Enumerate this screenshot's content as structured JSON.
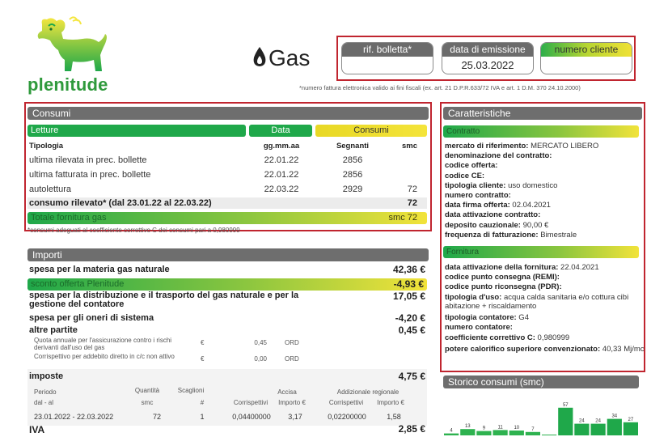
{
  "brand": {
    "name": "plenitude"
  },
  "product": {
    "title": "Gas"
  },
  "header": {
    "rif_bolletta_label": "rif. bolletta*",
    "rif_bolletta_value": "",
    "data_emissione_label": "data di emissione",
    "data_emissione_value": "25.03.2022",
    "numero_cliente_label": "numero cliente",
    "numero_cliente_value": "",
    "footnote": "*numero fattura elettronica valido ai fini fiscali (ex. art. 21 D.P.R.633/72 IVA e art. 1 D.M. 370 24.10.2000)"
  },
  "consumi": {
    "title": "Consumi",
    "bar_letture": "Letture",
    "bar_data": "Data",
    "bar_consumi": "Consumi",
    "col_tipologia": "Tipologia",
    "col_date_format": "gg.mm.aa",
    "col_segnanti": "Segnanti",
    "col_smc": "smc",
    "rows": [
      {
        "tipologia": "ultima rilevata in prec. bollette",
        "data": "22.01.22",
        "segnanti": "2856",
        "smc": ""
      },
      {
        "tipologia": "ultima fatturata in prec. bollette",
        "data": "22.01.22",
        "segnanti": "2856",
        "smc": ""
      },
      {
        "tipologia": "autolettura",
        "data": "22.03.22",
        "segnanti": "2929",
        "smc": "72"
      }
    ],
    "rilevato_label": "consumo rilevato* (dal 23.01.22 al 22.03.22)",
    "rilevato_value": "72",
    "totale_label": "Totale fornitura gas",
    "totale_value": "smc 72",
    "footnote": "*consumi adeguati al coefficiente correttivo C dei consumi pari a 0,980999"
  },
  "importi": {
    "title": "Importi",
    "materia_label": "spesa per la materia gas naturale",
    "materia_value": "42,36 €",
    "sconto_label": "sconto offerta Plenitude",
    "sconto_value": "-4,93 €",
    "distribuzione_label": "spesa per la distribuzione e il trasporto del gas naturale e per la gestione del contatore",
    "distribuzione_value": "17,05 €",
    "oneri_label": "spesa per gli oneri di sistema",
    "oneri_value": "-4,20 €",
    "altre_label": "altre partite",
    "altre_value": "0,45 €",
    "partite": [
      {
        "desc": "Quota annuale per l'assicurazione contro i rischi derivanti dall'uso del gas",
        "currency": "€",
        "amount": "0,45",
        "code": "ORD"
      },
      {
        "desc": "Corrispettivo per addebito diretto in c/c non attivo",
        "currency": "€",
        "amount": "0,00",
        "code": "ORD"
      }
    ],
    "imposte_label": "imposte",
    "imposte_value": "4,75 €",
    "tbl_periodo": "Periodo",
    "tbl_dal_al": "dal - al",
    "tbl_quantita": "Quantità",
    "tbl_smc": "smc",
    "tbl_scaglioni": "Scaglioni",
    "tbl_hash": "#",
    "tbl_accisa": "Accisa",
    "tbl_addizionale": "Addizionale regionale",
    "tbl_corrispettivi": "Corrispettivi",
    "tbl_importo": "Importo €",
    "tbl_row": {
      "periodo": "23.01.2022 - 22.03.2022",
      "quantita": "72",
      "scaglioni": "1",
      "corr_accisa": "0,04400000",
      "imp_accisa": "3,17",
      "corr_add": "0,02200000",
      "imp_add": "1,58"
    },
    "iva_label": "IVA",
    "iva_value": "2,85 €"
  },
  "caratteristiche": {
    "title": "Caratteristiche",
    "contratto_bar": "Contratto",
    "contratto": [
      {
        "k": "mercato di riferimento:",
        "v": " MERCATO LIBERO"
      },
      {
        "k": "denominazione del contratto:",
        "v": ""
      },
      {
        "k": "codice offerta:",
        "v": ""
      },
      {
        "k": "codice CE:",
        "v": ""
      },
      {
        "k": "tipologia cliente:",
        "v": " uso domestico"
      },
      {
        "k": "numero contratto:",
        "v": ""
      },
      {
        "k": "data firma offerta:",
        "v": " 02.04.2021"
      },
      {
        "k": "data attivazione contratto:",
        "v": ""
      },
      {
        "k": "deposito cauzionale:",
        "v": " 90,00 €"
      },
      {
        "k": "frequenza di fatturazione:",
        "v": " Bimestrale"
      }
    ],
    "fornitura_bar": "Fornitura",
    "fornitura": [
      {
        "k": "data attivazione della fornitura:",
        "v": " 22.04.2021"
      },
      {
        "k": "codice punto consegna (REMI):",
        "v": ""
      },
      {
        "k": "codice punto riconsegna (PDR):",
        "v": ""
      },
      {
        "k": "tipologia d'uso:",
        "v": " acqua calda sanitaria e/o cottura cibi abitazione + riscaldamento"
      },
      {
        "k": "tipologia contatore:",
        "v": " G4"
      },
      {
        "k": "numero contatore:",
        "v": ""
      },
      {
        "k": "coefficiente correttivo C:",
        "v": " 0,980999"
      },
      {
        "k": "potere calorifico superiore convenzionato:",
        "v": " 40,33 Mj/mc"
      }
    ]
  },
  "storico": {
    "title": "Storico consumi (smc)",
    "bar_labels": [
      "4",
      "13",
      "9",
      "11",
      "10",
      "7",
      "",
      "57",
      "24",
      "24",
      "34",
      "27"
    ]
  }
}
